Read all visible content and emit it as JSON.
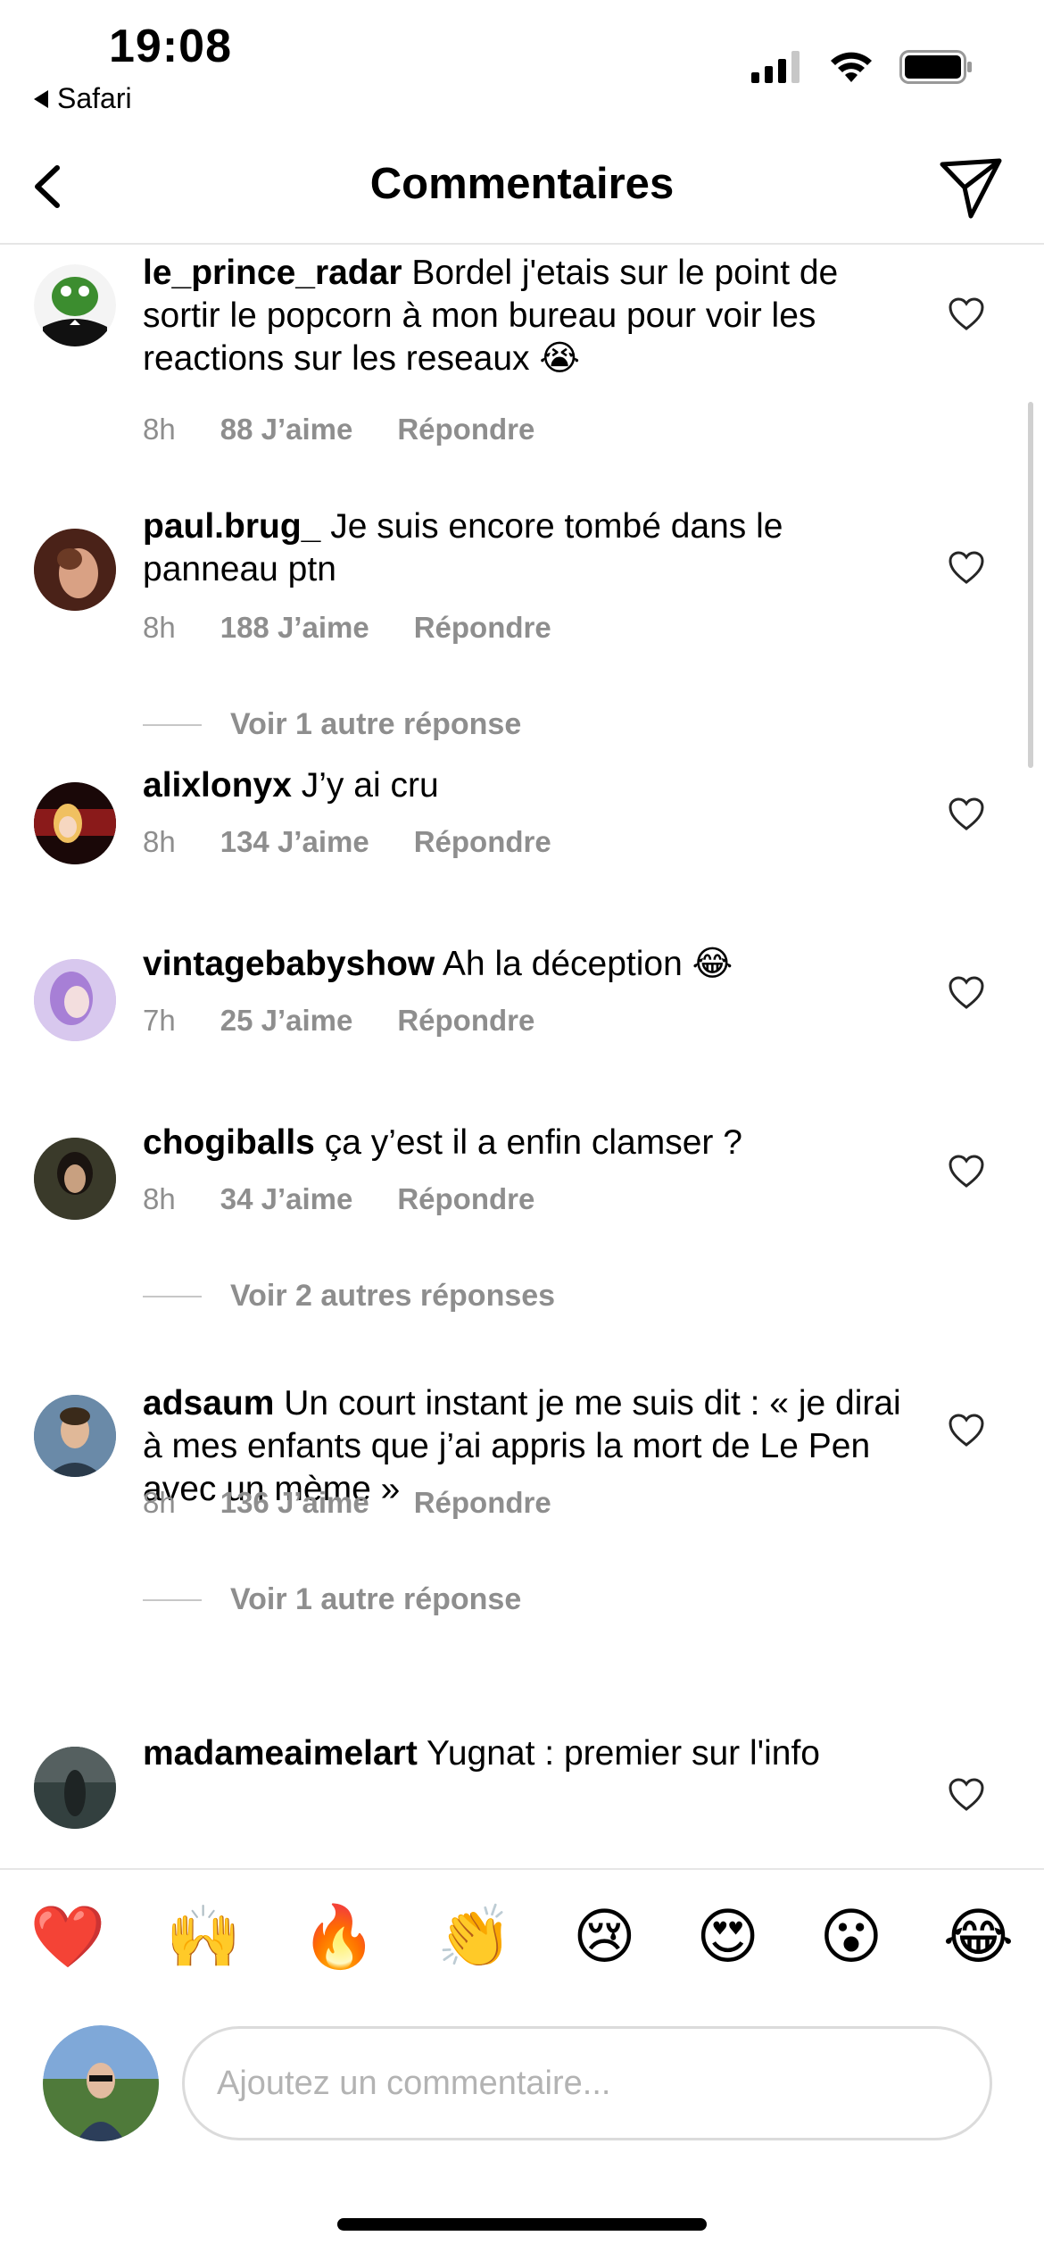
{
  "status": {
    "time": "19:08",
    "back_app": "Safari"
  },
  "header": {
    "title": "Commentaires"
  },
  "comments": [
    {
      "user": "le_prince_radar",
      "text": "Bordel j'etais sur le point de sortir le popcorn à mon bureau pour voir les reactions sur les reseaux 😭",
      "time": "8h",
      "likes": "88 J’aime",
      "reply": "Répondre"
    },
    {
      "user": "paul.brug_",
      "text": "Je suis encore tombé dans le panneau ptn",
      "time": "8h",
      "likes": "188 J’aime",
      "reply": "Répondre",
      "view_more": "Voir 1 autre réponse"
    },
    {
      "user": "alixlonyx",
      "text": "J’y ai cru",
      "time": "8h",
      "likes": "134 J’aime",
      "reply": "Répondre"
    },
    {
      "user": "vintagebabyshow",
      "text": "Ah la déception 😂",
      "time": "7h",
      "likes": "25 J’aime",
      "reply": "Répondre"
    },
    {
      "user": "chogiballs",
      "text": "ça y’est il a enfin clamser ?",
      "time": "8h",
      "likes": "34 J’aime",
      "reply": "Répondre",
      "view_more": "Voir 2 autres réponses"
    },
    {
      "user": "adsaum",
      "text": "Un court instant je me suis dit : « je dirai à mes enfants que j’ai appris la mort de Le Pen avec un mème »",
      "time": "8h",
      "likes": "136 J’aime",
      "reply": "Répondre",
      "view_more": "Voir 1 autre réponse"
    },
    {
      "user": "madameaimelart",
      "text": "Yugnat : premier sur l'info"
    }
  ],
  "emoji_bar": [
    "❤️",
    "🙌",
    "🔥",
    "👏",
    "😢",
    "😍",
    "😮",
    "😂"
  ],
  "composer": {
    "placeholder": "Ajoutez un commentaire..."
  },
  "colors": {
    "meta_gray": "#8e8e8e",
    "divider": "#e6e6e6"
  }
}
